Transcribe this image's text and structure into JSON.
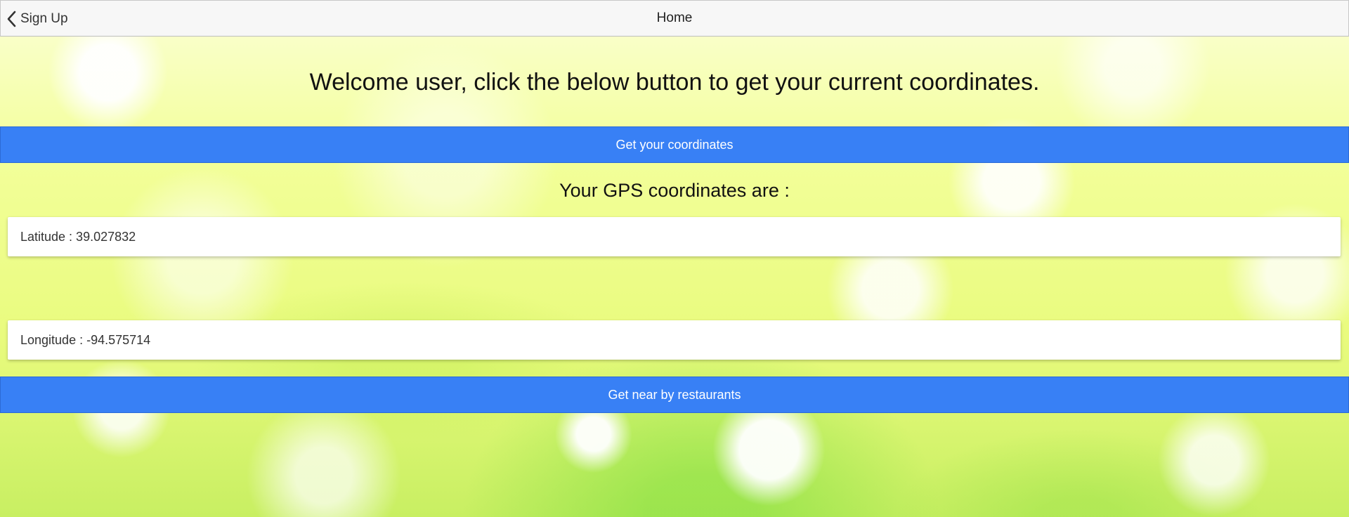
{
  "navbar": {
    "back_label": "Sign Up",
    "title": "Home"
  },
  "main": {
    "welcome_text": "Welcome user, click the below button to get your current coordinates.",
    "get_coordinates_label": "Get your coordinates",
    "gps_heading": "Your GPS coordinates are :",
    "latitude_text": "Latitude : 39.027832",
    "longitude_text": "Longitude : -94.575714",
    "get_restaurants_label": "Get near by restaurants"
  },
  "colors": {
    "primary_button": "#3880f5",
    "navbar_background": "#f7f7f7"
  },
  "icons": {
    "back": "chevron-left-icon"
  }
}
